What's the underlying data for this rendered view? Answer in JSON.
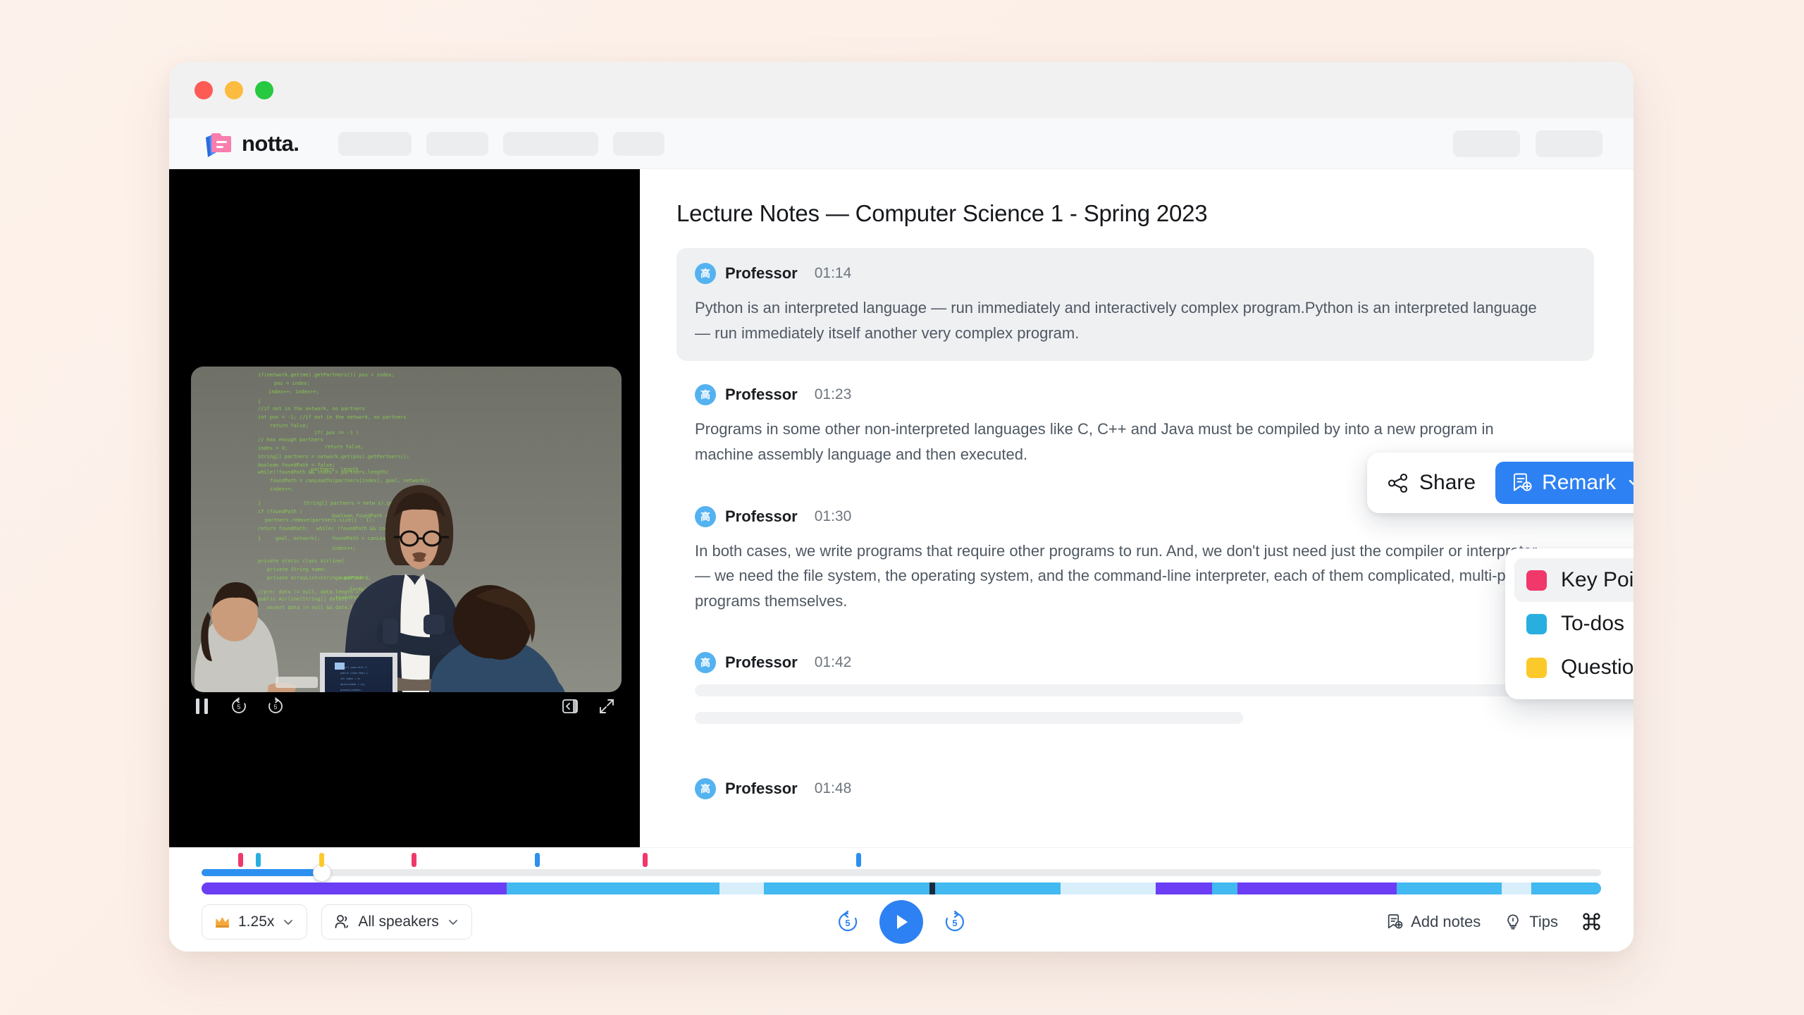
{
  "window": {
    "traffic_lights": [
      "close",
      "minimize",
      "maximize"
    ]
  },
  "navbar": {
    "brand": "notta.",
    "brand_icon": "notta-folder-logo",
    "left_placeholders": 4,
    "right_placeholders": 2
  },
  "video": {
    "photo_alt": "classroom-lecture-photo",
    "controls": {
      "pause": "pause-icon",
      "rewind": "rewind-5-icon",
      "forward": "forward-5-icon",
      "sidebar_toggle": "panel-collapse-icon",
      "fullscreen": "expand-icon"
    }
  },
  "document": {
    "title": "Lecture Notes — Computer Science 1 - Spring 2023",
    "blocks": [
      {
        "speaker": "Professor",
        "avatar_glyph": "高",
        "time": "01:14",
        "text": "Python is an interpreted language — run immediately and interactively complex program.Python is an interpreted language — run immediately itself another very complex program.",
        "active": true
      },
      {
        "speaker": "Professor",
        "avatar_glyph": "高",
        "time": "01:23",
        "text": "Programs in some other non-interpreted languages like C, C++ and Java must be compiled by into a new program in machine assembly language and then executed.",
        "active": false
      },
      {
        "speaker": "Professor",
        "avatar_glyph": "高",
        "time": "01:30",
        "text": "In both cases, we write programs that require other programs to run. And, we don't just need just the compiler or interpreter — we need the file system, the operating system, and the command-line interpreter, each of them complicated, multi-part programs themselves.",
        "active": false
      },
      {
        "speaker": "Professor",
        "avatar_glyph": "高",
        "time": "01:42",
        "text": "",
        "active": false
      },
      {
        "speaker": "Professor",
        "avatar_glyph": "高",
        "time": "01:48",
        "text": "",
        "active": false
      }
    ]
  },
  "toolbar": {
    "share_label": "Share",
    "share_icon": "share-nodes-icon",
    "remark_label": "Remark",
    "remark_icon": "bookmark-plus-icon",
    "chevron_icon": "chevron-down-icon",
    "accent": "#2D81F2"
  },
  "remark_menu": {
    "items": [
      {
        "label": "Key Points",
        "color": "#F0386B",
        "hover": true
      },
      {
        "label": "To-dos",
        "color": "#29AEE0",
        "hover": false
      },
      {
        "label": "Questions",
        "color": "#FCC92A",
        "hover": false
      }
    ]
  },
  "cursor": {
    "type": "pointing-hand"
  },
  "player": {
    "speed": {
      "label": "1.25x",
      "icon": "crown-icon",
      "chevron": "chevron-down-icon"
    },
    "speakers": {
      "label": "All speakers",
      "icon": "people-icon",
      "chevron": "chevron-down-icon"
    },
    "rewind_label": "5",
    "forward_label": "5",
    "play_icon": "play-icon",
    "add_notes": {
      "label": "Add notes",
      "icon": "bookmark-plus-icon"
    },
    "tips": {
      "label": "Tips",
      "icon": "lightbulb-icon"
    },
    "shortcut_icon": "command-key-icon",
    "progress_percent": 8.6,
    "markers": [
      {
        "pos": 2.6,
        "color": "#F0386B"
      },
      {
        "pos": 3.9,
        "color": "#29AEE0"
      },
      {
        "pos": 8.4,
        "color": "#FCC92A"
      },
      {
        "pos": 15.0,
        "color": "#F0386B"
      },
      {
        "pos": 23.8,
        "color": "#2D8FEF"
      },
      {
        "pos": 31.5,
        "color": "#F0386B"
      },
      {
        "pos": 46.8,
        "color": "#2D8FEF"
      }
    ],
    "segments": [
      {
        "start": 0.0,
        "width": 21.8,
        "color": "#6B3EF5"
      },
      {
        "start": 21.8,
        "width": 15.2,
        "color": "#42B9F0"
      },
      {
        "start": 37.0,
        "width": 3.2,
        "color": "#D8EEFB"
      },
      {
        "start": 40.2,
        "width": 11.8,
        "color": "#42B9F0"
      },
      {
        "start": 52.0,
        "width": 0.4,
        "color": "#1B2A3A"
      },
      {
        "start": 52.4,
        "width": 9.0,
        "color": "#42B9F0"
      },
      {
        "start": 61.4,
        "width": 6.8,
        "color": "#D8EEFB"
      },
      {
        "start": 68.2,
        "width": 4.0,
        "color": "#6B3EF5"
      },
      {
        "start": 72.2,
        "width": 1.8,
        "color": "#42B9F0"
      },
      {
        "start": 74.0,
        "width": 11.4,
        "color": "#6B3EF5"
      },
      {
        "start": 85.4,
        "width": 7.5,
        "color": "#42B9F0"
      },
      {
        "start": 92.9,
        "width": 2.1,
        "color": "#D8EEFB"
      },
      {
        "start": 95.0,
        "width": 5.0,
        "color": "#42B9F0"
      }
    ]
  }
}
